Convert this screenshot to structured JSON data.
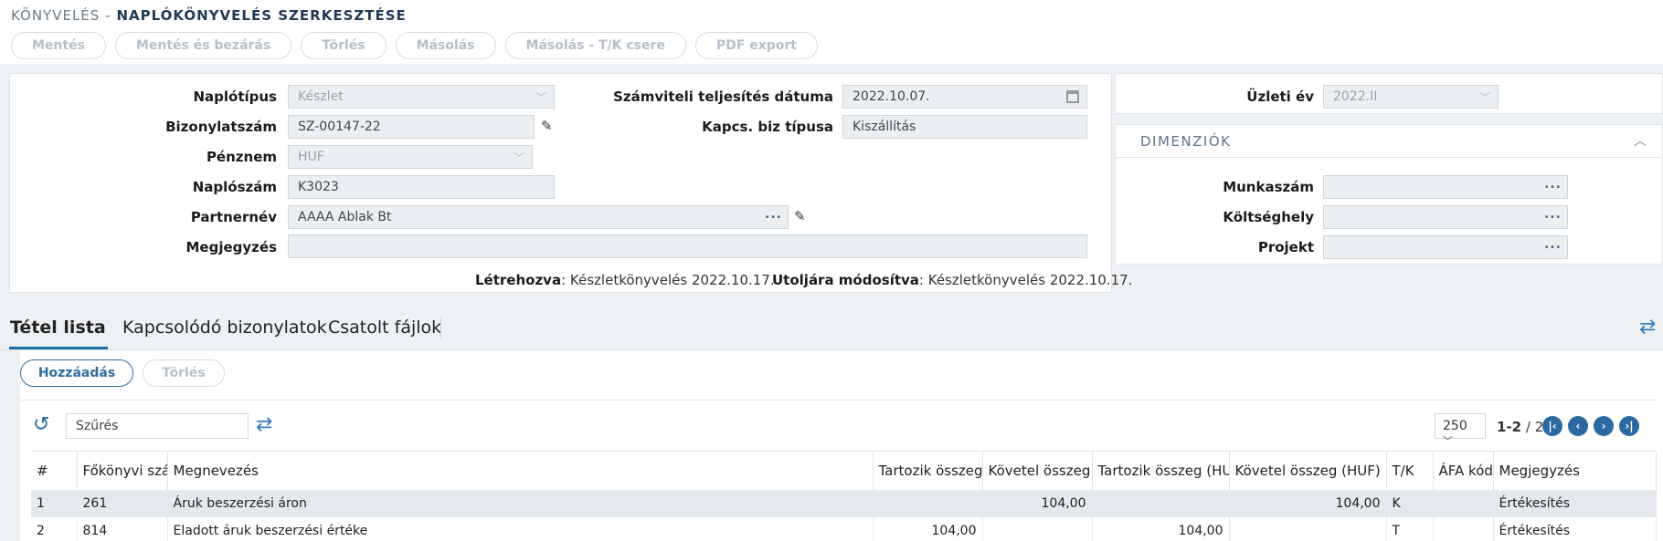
{
  "header": {
    "breadcrumb": "KÖNYVELÉS -",
    "title": "NAPLÓKÖNYVELÉS SZERKESZTÉSE",
    "toolbar": [
      "Mentés",
      "Mentés és bezárás",
      "Törlés",
      "Másolás",
      "Másolás - T/K csere",
      "PDF export"
    ]
  },
  "form": {
    "naplotipus_label": "Naplótípus",
    "naplotipus_value": "Készlet",
    "bizonylatszam_label": "Bizonylatszám",
    "bizonylatszam_value": "SZ-00147-22",
    "penznem_label": "Pénznem",
    "penznem_value": "HUF",
    "naploszam_label": "Naplószám",
    "naploszam_value": "K3023",
    "partnernev_label": "Partnernév",
    "partnernev_value": "AAAA Ablak Bt",
    "megjegyzes_label": "Megjegyzés",
    "megjegyzes_value": "",
    "datum_label": "Számviteli teljesítés dátuma",
    "datum_value": "2022.10.07.",
    "kapcs_label": "Kapcs. biz típusa",
    "kapcs_value": "Kiszállítás",
    "created_label": "Létrehozva",
    "created_value": ": Készletkönyvelés 2022.10.17.",
    "modified_label": "Utoljára módosítva",
    "modified_value": ": Készletkönyvelés 2022.10.17.",
    "dots": "...",
    "chevron": "﹀"
  },
  "side": {
    "uzleti_ev_label": "Üzleti év",
    "uzleti_ev_value": "2022.II",
    "dimenziok_title": "DIMENZIÓK",
    "munkaszam_label": "Munkaszám",
    "koltseghely_label": "Költséghely",
    "projekt_label": "Projekt"
  },
  "tabs": [
    "Tétel lista",
    "Kapcsolódó bizonylatok",
    "Csatolt fájlok"
  ],
  "grid": {
    "add_label": "Hozzáadás",
    "delete_label": "Törlés",
    "filter_placeholder": "Szűrés",
    "page_size": "250",
    "page_range": "1-2",
    "page_total": "/ 2",
    "columns": [
      "#",
      "Főkönyvi szám",
      "Megnevezés",
      "Tartozik összeg",
      "Követel összeg",
      "Tartozik összeg (HUF)",
      "Követel összeg (HUF)",
      "T/K",
      "ÁFA kód",
      "Megjegyzés"
    ],
    "rows": [
      [
        "1",
        "261",
        "Áruk beszerzési áron",
        "",
        "104,00",
        "",
        "104,00",
        "K",
        "",
        "Értékesítés"
      ],
      [
        "2",
        "814",
        "Eladott áruk beszerzési értéke",
        "104,00",
        "",
        "104,00",
        "",
        "T",
        "",
        "Értékesítés"
      ]
    ]
  },
  "colors": {
    "accent": "#2c6d9e",
    "title": "#1f3a57"
  }
}
